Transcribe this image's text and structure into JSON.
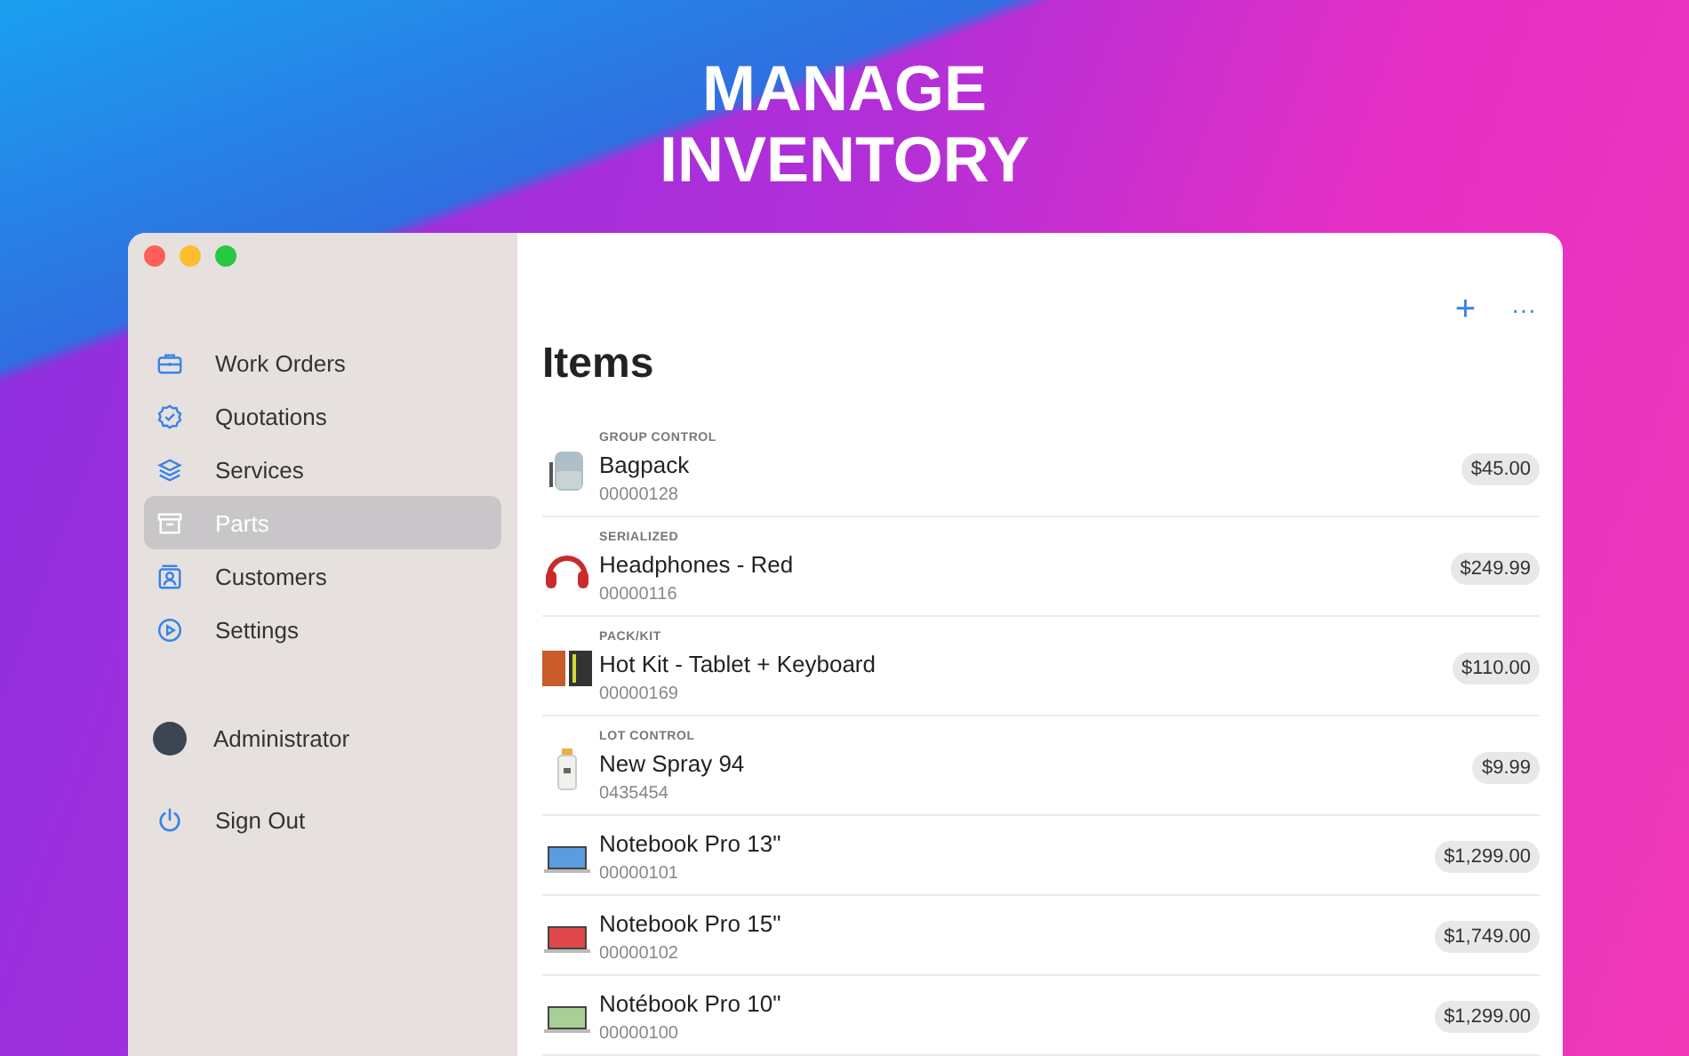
{
  "headline": [
    "MANAGE",
    "INVENTORY"
  ],
  "sidebar": {
    "items": [
      {
        "label": "Work Orders",
        "selected": false
      },
      {
        "label": "Quotations",
        "selected": false
      },
      {
        "label": "Services",
        "selected": false
      },
      {
        "label": "Parts",
        "selected": true
      },
      {
        "label": "Customers",
        "selected": false
      },
      {
        "label": "Settings",
        "selected": false
      }
    ],
    "user": "Administrator",
    "sign_out": "Sign Out"
  },
  "toolbar": {
    "add": "+",
    "more": "···"
  },
  "title": "Items",
  "items": [
    {
      "type": "GROUP CONTROL",
      "name": "Bagpack",
      "code": "00000128",
      "price": "$45.00"
    },
    {
      "type": "SERIALIZED",
      "name": "Headphones - Red",
      "code": "00000116",
      "price": "$249.99"
    },
    {
      "type": "PACK/KIT",
      "name": "Hot Kit - Tablet + Keyboard",
      "code": "00000169",
      "price": "$110.00"
    },
    {
      "type": "LOT CONTROL",
      "name": "New Spray 94",
      "code": "0435454",
      "price": "$9.99"
    },
    {
      "name": "Notebook Pro 13\"",
      "code": "00000101",
      "price": "$1,299.00"
    },
    {
      "name": "Notebook Pro 15\"",
      "code": "00000102",
      "price": "$1,749.00"
    },
    {
      "name": "Notébook Pro 10\"",
      "code": "00000100",
      "price": "$1,299.00"
    }
  ]
}
